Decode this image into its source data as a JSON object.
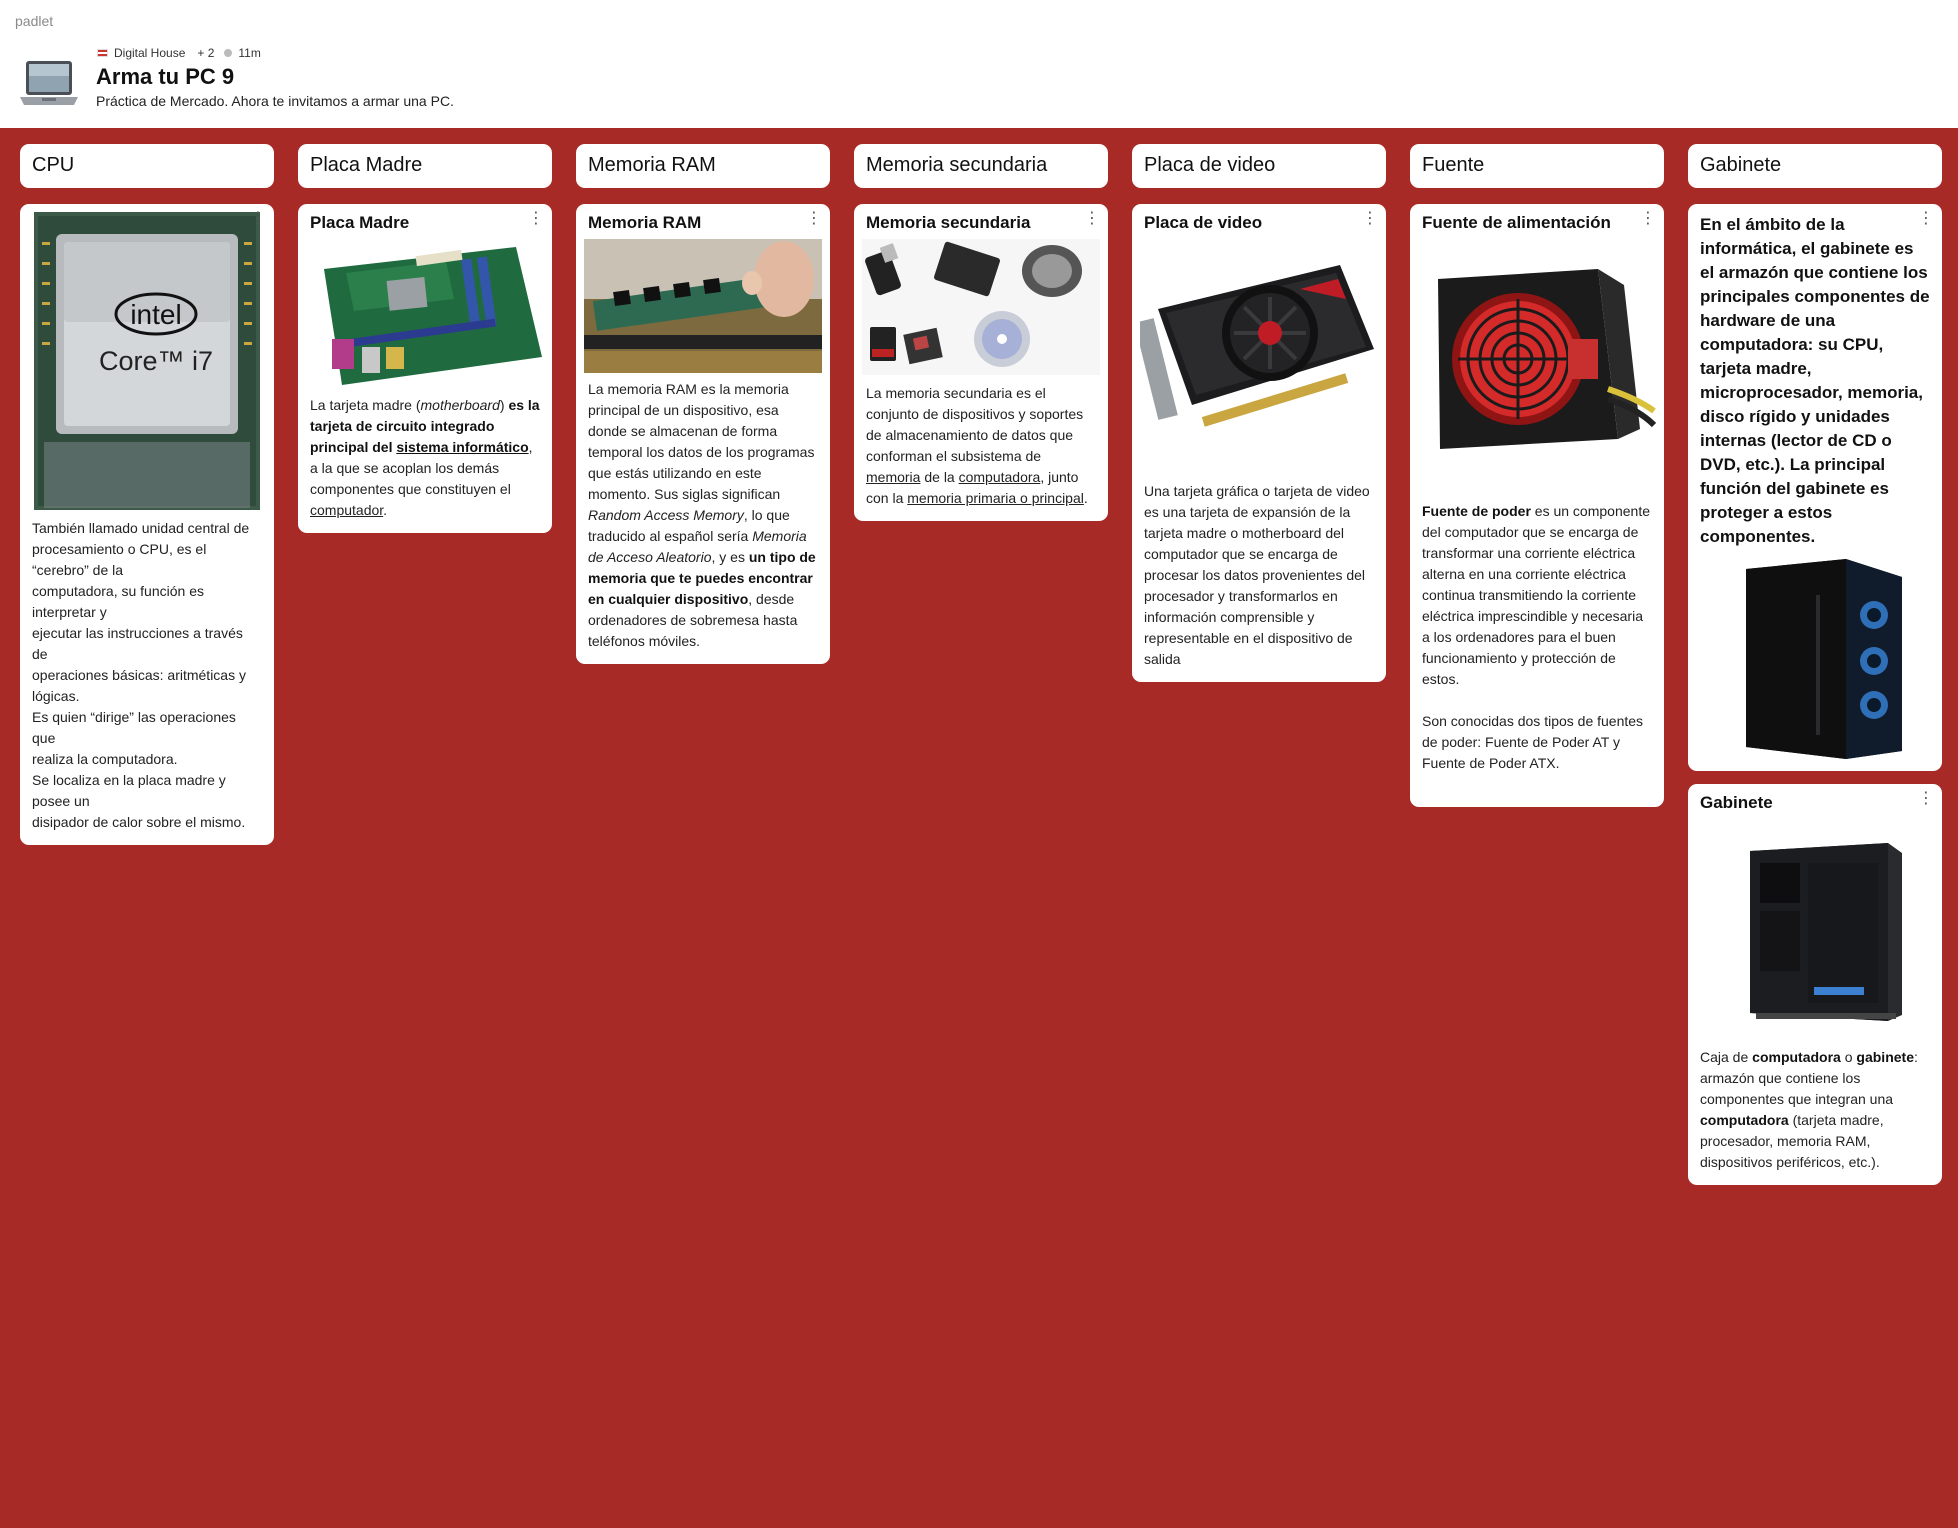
{
  "app": {
    "brand": "padlet"
  },
  "header": {
    "author": "Digital House",
    "collaborators": "+ 2",
    "time_ago": "11m",
    "title": "Arma tu PC 9",
    "subtitle": "Práctica de Mercado. Ahora te invitamos a armar una PC.",
    "icon": "laptop-icon"
  },
  "theme": {
    "background": "#a82a26",
    "card": "#ffffff"
  },
  "columns": [
    {
      "title": "CPU",
      "cards": [
        {
          "image": "intel-core-i7-chip",
          "body": [
            "También llamado unidad central de procesamiento o CPU, es el",
            "“cerebro” de la",
            "computadora, su función es interpretar y",
            "ejecutar las instrucciones a través de",
            "operaciones básicas: aritméticas y lógicas.",
            "Es quien “dirige” las operaciones que",
            "realiza la computadora.",
            "Se localiza en la placa madre y posee un",
            "disipador de calor sobre el mismo."
          ]
        }
      ]
    },
    {
      "title": "Placa Madre",
      "cards": [
        {
          "title": "Placa Madre",
          "image": "motherboard",
          "body": [
            " La tarjeta madre (",
            "motherboard",
            ") ",
            "es la tarjeta de circuito integrado principal del ",
            "sistema informático",
            ", a la que se acoplan los demás componentes que constituyen el ",
            "computador",
            "."
          ]
        }
      ]
    },
    {
      "title": "Memoria RAM",
      "cards": [
        {
          "title": "Memoria RAM",
          "image": "ram-module",
          "body": [
            "La memoria RAM es la memoria principal de un dispositivo, esa donde se almacenan de forma temporal los datos de los programas que estás utilizando en este momento. Sus siglas significan ",
            "Random Access Memory",
            ", lo que traducido al español sería ",
            "Memoria de Acceso Aleatorio",
            ", y es ",
            "un tipo de memoria que te puedes encontrar en cualquier dispositivo",
            ", desde ordenadores de sobremesa hasta teléfonos móviles."
          ]
        }
      ]
    },
    {
      "title": "Memoria secundaria",
      "cards": [
        {
          "title": "Memoria secundaria",
          "image": "storage-devices",
          "body": [
            "La memoria secundaria es el conjunto de dispositivos y soportes de almacenamiento de datos que conforman el subsistema de ",
            "memoria",
            " de la ",
            "computadora",
            ", junto con la ",
            "memoria primaria o principal",
            "."
          ]
        }
      ]
    },
    {
      "title": "Placa de video",
      "cards": [
        {
          "title": "Placa de video",
          "image": "graphics-card",
          "body": [
            "Una tarjeta gráfica o tarjeta de video es una tarjeta de expansión de la tarjeta madre o motherboard del computador que se encarga de procesar los datos provenientes del procesador y transformarlos en información comprensible y representable en el dispositivo de salida"
          ]
        }
      ]
    },
    {
      "title": "Fuente",
      "cards": [
        {
          "title": "Fuente de alimentación",
          "image": "power-supply",
          "body": [
            "Fuente de poder",
            " es un componente del computador que se encarga de transformar una corriente eléctrica alterna en una corriente eléctrica continua transmitiendo la corriente eléctrica imprescindible y necesaria a los ordenadores para el buen funcionamiento y protección de estos.",
            "Son conocidas dos tipos de fuentes de poder: Fuente de Poder AT y Fuente de Poder ATX."
          ]
        }
      ]
    },
    {
      "title": "Gabinete",
      "cards": [
        {
          "image": "pc-case-rgb",
          "body": [
            "En el ámbito de la informática, el gabinete es el armazón que contiene los principales componentes de hardware de una computadora: su CPU, tarjeta madre, microprocesador, memoria, disco rígido y unidades internas (lector de CD o DVD, etc.). La principal función del gabinete es proteger a estos componentes."
          ]
        },
        {
          "title": "Gabinete",
          "image": "pc-case-black",
          "body": [
            "Caja de ",
            "computadora",
            " o ",
            "gabinete",
            ": armazón que contiene los componentes que integran una ",
            "computadora",
            " (tarjeta madre, procesador, memoria RAM, dispositivos periféricos, etc.)."
          ]
        }
      ]
    }
  ]
}
